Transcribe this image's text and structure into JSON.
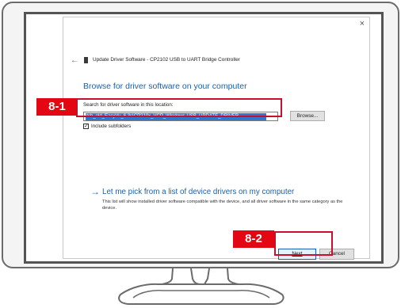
{
  "dialog": {
    "close_icon": "×",
    "back_icon": "←",
    "title": "Update Driver Software - CP2102 USB to UART Bridge Controller",
    "heading": "Browse for driver software on your computer",
    "location_label": "Search for driver software in this location:",
    "path_value": "itch_old_EasyVu_6.3s\\CP210x_VCP_Windows-USB_UPDATE_DRIVER",
    "dropdown_icon": "chevron-down-icon",
    "browse_label": "Browse...",
    "include_subfolders_label": "Include subfolders",
    "include_subfolders_checked": true,
    "pick_link": "Let me pick from a list of device drivers on my computer",
    "pick_description": "This list will show installed driver software compatible with the device, and all driver software in the same category as the device.",
    "next_label": "Next",
    "cancel_label": "Cancel"
  },
  "annotations": {
    "step_1_label": "8-1",
    "step_2_label": "8-2",
    "highlight_color": "#c8102e",
    "badge_color": "#e30613"
  },
  "colors": {
    "link_blue": "#1f5f9c",
    "selection_blue": "#3377cc"
  }
}
